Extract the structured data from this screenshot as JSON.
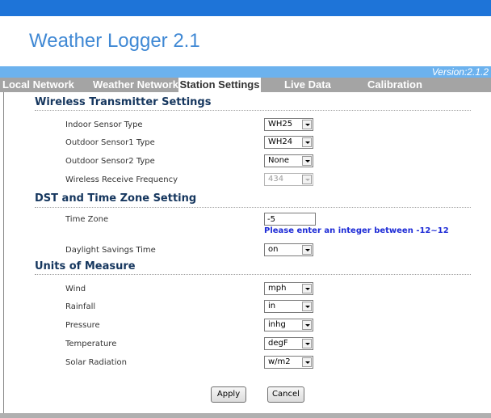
{
  "app": {
    "title": "Weather Logger 2.1",
    "version": "Version:2.1.2"
  },
  "tabs": [
    {
      "label": "Local Network",
      "active": false
    },
    {
      "label": "Weather Network",
      "active": false
    },
    {
      "label": "Station Settings",
      "active": true
    },
    {
      "label": "Live Data",
      "active": false
    },
    {
      "label": "Calibration",
      "active": false
    }
  ],
  "wireless": {
    "title": "Wireless Transmitter Settings",
    "indoor_label": "Indoor Sensor Type",
    "indoor_value": "WH25",
    "outdoor1_label": "Outdoor Sensor1 Type",
    "outdoor1_value": "WH24",
    "outdoor2_label": "Outdoor Sensor2 Type",
    "outdoor2_value": "None",
    "freq_label": "Wireless Receive Frequency",
    "freq_value": "434"
  },
  "dst": {
    "title": "DST and Time Zone Setting",
    "tz_label": "Time Zone",
    "tz_value": "-5",
    "tz_hint": "Please enter an integer between -12~12",
    "dst_label": "Daylight Savings Time",
    "dst_value": "on"
  },
  "units": {
    "title": "Units of Measure",
    "wind_label": "Wind",
    "wind_value": "mph",
    "rain_label": "Rainfall",
    "rain_value": "in",
    "pressure_label": "Pressure",
    "pressure_value": "inhg",
    "temp_label": "Temperature",
    "temp_value": "degF",
    "solar_label": "Solar Radiation",
    "solar_value": "w/m2"
  },
  "buttons": {
    "apply": "Apply",
    "cancel": "Cancel"
  },
  "colors": {
    "topbar": "#1e74d8",
    "title": "#3f88d4",
    "version_bar": "#6cb2ee",
    "tabbar": "#a4a4a4",
    "section": "#15365e",
    "hint": "#1d2bd6"
  }
}
